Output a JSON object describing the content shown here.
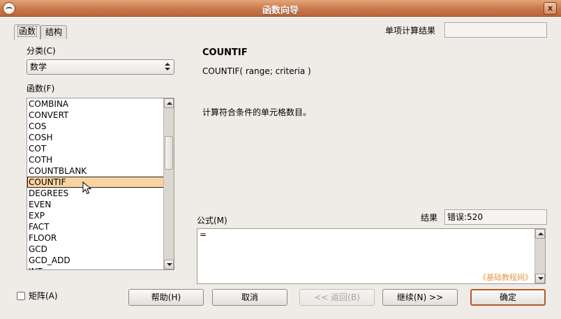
{
  "window": {
    "title": "函数向导",
    "close_glyph": "x"
  },
  "tabs": [
    {
      "label": "函数"
    },
    {
      "label": "结构"
    }
  ],
  "single_result": {
    "label": "单项计算结果",
    "value": ""
  },
  "category": {
    "label": "分类(C)",
    "value": "数学"
  },
  "functions": {
    "label": "函数(F)",
    "items": [
      "COMBINA",
      "CONVERT",
      "COS",
      "COSH",
      "COT",
      "COTH",
      "COUNTBLANK",
      "COUNTIF",
      "DEGREES",
      "EVEN",
      "EXP",
      "FACT",
      "FLOOR",
      "GCD",
      "GCD_ADD",
      "INT"
    ],
    "selected": "COUNTIF"
  },
  "detail": {
    "name": "COUNTIF",
    "syntax": "COUNTIF( range; criteria  )",
    "description": "计算符合条件的单元格数目。"
  },
  "formula": {
    "label": "公式(M)",
    "value": "="
  },
  "result": {
    "label": "结果",
    "value": "错误:520"
  },
  "watermark": "《基础教程网》",
  "matrix": {
    "label": "矩阵(A)",
    "checked": false
  },
  "buttons": {
    "help": "帮助(H)",
    "cancel": "取消",
    "back": "<< 返回(B)",
    "next": "继续(N) >>",
    "ok": "确定"
  }
}
